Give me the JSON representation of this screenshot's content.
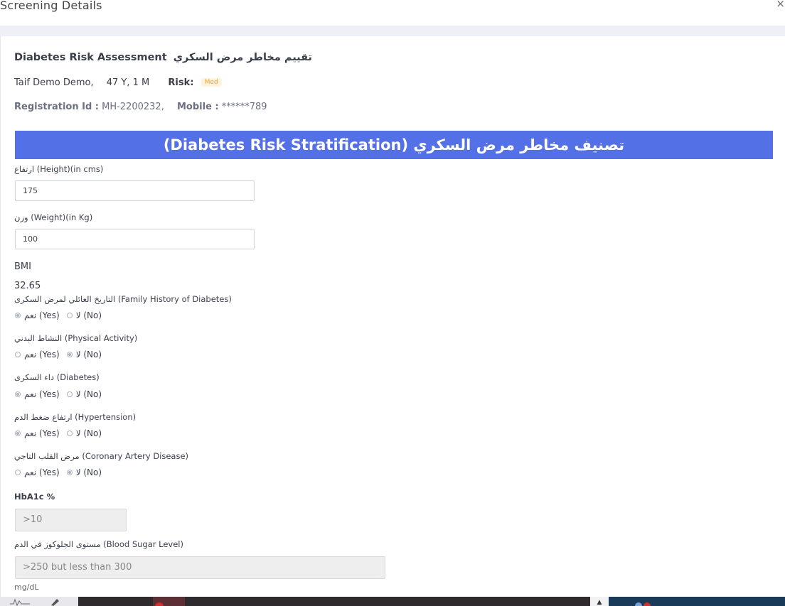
{
  "modal": {
    "title": "Screening Details",
    "close": "×"
  },
  "assessment": {
    "title": "Diabetes Risk Assessment",
    "title_ar": "تقييم مخاطر مرض السكري"
  },
  "patient": {
    "name": "Taif Demo Demo,",
    "age": "47 Y, 1 M",
    "risk_label": "Risk:",
    "risk_value": "Med",
    "reg_label": "Registration Id :",
    "reg_value": "MH-2200232,",
    "mobile_label": "Mobile :",
    "mobile_value": "******789"
  },
  "banner": "(Diabetes Risk Stratification) تصنيف مخاطر مرض السكري",
  "fields": {
    "height": {
      "label": "ارتفاع (Height)(in cms)",
      "value": "175"
    },
    "weight": {
      "label": "وزن (Weight)(in Kg)",
      "value": "100"
    },
    "bmi": {
      "label": "BMI",
      "value": "32.65"
    }
  },
  "questions": [
    {
      "label": "التاريخ العائلي لمرض السكرى (Family History of Diabetes)",
      "yes": "نعم (Yes)",
      "no": "لا (No)",
      "selected": "yes"
    },
    {
      "label": "النشاط البدني (Physical Activity)",
      "yes": "نعم (Yes)",
      "no": "لا (No)",
      "selected": "no"
    },
    {
      "label": "داء السكرى (Diabetes)",
      "yes": "نعم (Yes)",
      "no": "لا (No)",
      "selected": "yes"
    },
    {
      "label": "ارتفاع ضغط الدم (Hypertension)",
      "yes": "نعم (Yes)",
      "no": "لا (No)",
      "selected": "yes"
    },
    {
      "label": "مرض القلب التاجي (Coronary Artery Disease)",
      "yes": "نعم (Yes)",
      "no": "لا (No)",
      "selected": "no"
    }
  ],
  "hba1c": {
    "label": "HbA1c %",
    "value": ">10"
  },
  "blood_sugar": {
    "label": "مستوى الجلوكوز في الدم (Blood Sugar Level)",
    "value": ">250 but less than 300",
    "unit": "mg/dL"
  },
  "colors": {
    "banner": "#5470e6",
    "risk_badge_text": "#f0a030",
    "risk_badge_bg": "#fff3dc"
  }
}
